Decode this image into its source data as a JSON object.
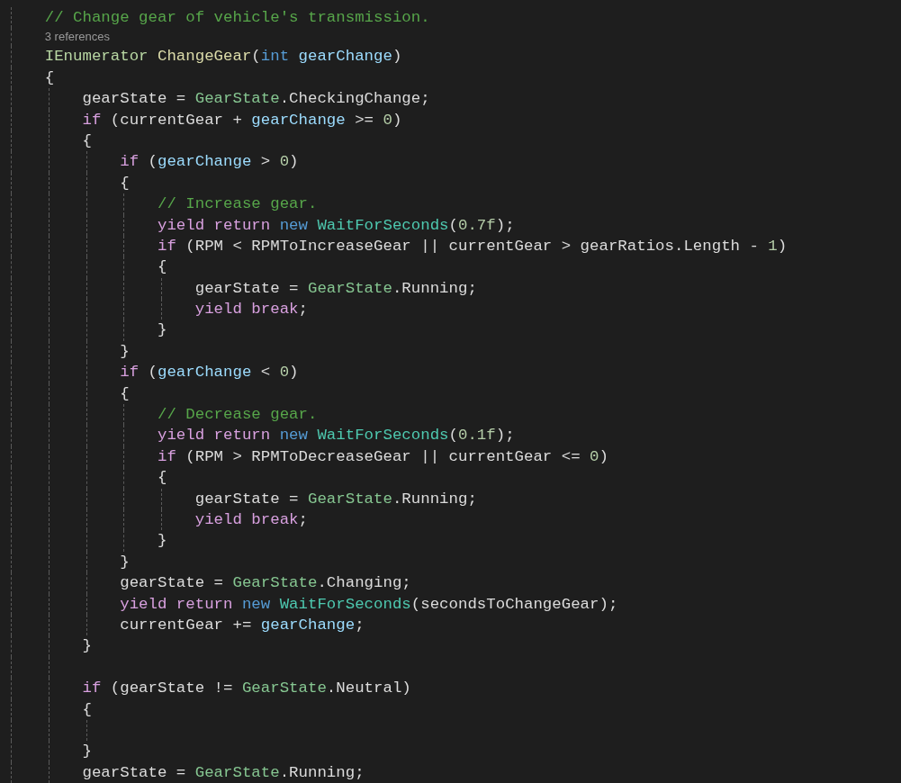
{
  "editor": {
    "lines": [
      {
        "kind": "code",
        "tokens": [
          {
            "text": "    // Change gear of vehicle's transmission.",
            "kind": "comment"
          }
        ]
      },
      {
        "kind": "codelens",
        "text": "3 references"
      },
      {
        "kind": "code",
        "tokens": [
          {
            "text": "    IEnumerator ",
            "kind": "interface"
          },
          {
            "text": "ChangeGear",
            "kind": "method"
          },
          {
            "text": "(",
            "kind": "plain"
          },
          {
            "text": "int ",
            "kind": "typekw"
          },
          {
            "text": "gearChange",
            "kind": "param"
          },
          {
            "text": ")",
            "kind": "plain"
          }
        ]
      },
      {
        "kind": "code",
        "tokens": [
          {
            "text": "    {",
            "kind": "plain"
          }
        ]
      },
      {
        "kind": "code",
        "tokens": [
          {
            "text": "        gearState = ",
            "kind": "plain"
          },
          {
            "text": "GearState",
            "kind": "enum"
          },
          {
            "text": ".CheckingChange;",
            "kind": "plain"
          }
        ]
      },
      {
        "kind": "code",
        "tokens": [
          {
            "text": "        if",
            "kind": "control"
          },
          {
            "text": " (currentGear + ",
            "kind": "plain"
          },
          {
            "text": "gearChange",
            "kind": "param"
          },
          {
            "text": " >= ",
            "kind": "plain"
          },
          {
            "text": "0",
            "kind": "number"
          },
          {
            "text": ")",
            "kind": "plain"
          }
        ]
      },
      {
        "kind": "code",
        "tokens": [
          {
            "text": "        {",
            "kind": "plain"
          }
        ]
      },
      {
        "kind": "code",
        "tokens": [
          {
            "text": "            if",
            "kind": "control"
          },
          {
            "text": " (",
            "kind": "plain"
          },
          {
            "text": "gearChange",
            "kind": "param"
          },
          {
            "text": " > ",
            "kind": "plain"
          },
          {
            "text": "0",
            "kind": "number"
          },
          {
            "text": ")",
            "kind": "plain"
          }
        ]
      },
      {
        "kind": "code",
        "tokens": [
          {
            "text": "            {",
            "kind": "plain"
          }
        ]
      },
      {
        "kind": "code",
        "tokens": [
          {
            "text": "                // Increase gear.",
            "kind": "comment"
          }
        ]
      },
      {
        "kind": "code",
        "tokens": [
          {
            "text": "                yield return ",
            "kind": "control"
          },
          {
            "text": "new ",
            "kind": "typekw"
          },
          {
            "text": "WaitForSeconds",
            "kind": "class"
          },
          {
            "text": "(",
            "kind": "plain"
          },
          {
            "text": "0.7f",
            "kind": "number"
          },
          {
            "text": ");",
            "kind": "plain"
          }
        ]
      },
      {
        "kind": "code",
        "tokens": [
          {
            "text": "                if",
            "kind": "control"
          },
          {
            "text": " (RPM < RPMToIncreaseGear || currentGear > gearRatios.Length - ",
            "kind": "plain"
          },
          {
            "text": "1",
            "kind": "number"
          },
          {
            "text": ")",
            "kind": "plain"
          }
        ]
      },
      {
        "kind": "code",
        "tokens": [
          {
            "text": "                {",
            "kind": "plain"
          }
        ]
      },
      {
        "kind": "code",
        "tokens": [
          {
            "text": "                    gearState = ",
            "kind": "plain"
          },
          {
            "text": "GearState",
            "kind": "enum"
          },
          {
            "text": ".Running;",
            "kind": "plain"
          }
        ]
      },
      {
        "kind": "code",
        "tokens": [
          {
            "text": "                    yield break",
            "kind": "control"
          },
          {
            "text": ";",
            "kind": "plain"
          }
        ]
      },
      {
        "kind": "code",
        "tokens": [
          {
            "text": "                }",
            "kind": "plain"
          }
        ]
      },
      {
        "kind": "code",
        "tokens": [
          {
            "text": "            }",
            "kind": "plain"
          }
        ]
      },
      {
        "kind": "code",
        "tokens": [
          {
            "text": "            if",
            "kind": "control"
          },
          {
            "text": " (",
            "kind": "plain"
          },
          {
            "text": "gearChange",
            "kind": "param"
          },
          {
            "text": " < ",
            "kind": "plain"
          },
          {
            "text": "0",
            "kind": "number"
          },
          {
            "text": ")",
            "kind": "plain"
          }
        ]
      },
      {
        "kind": "code",
        "tokens": [
          {
            "text": "            {",
            "kind": "plain"
          }
        ]
      },
      {
        "kind": "code",
        "tokens": [
          {
            "text": "                // Decrease gear.",
            "kind": "comment"
          }
        ]
      },
      {
        "kind": "code",
        "tokens": [
          {
            "text": "                yield return ",
            "kind": "control"
          },
          {
            "text": "new ",
            "kind": "typekw"
          },
          {
            "text": "WaitForSeconds",
            "kind": "class"
          },
          {
            "text": "(",
            "kind": "plain"
          },
          {
            "text": "0.1f",
            "kind": "number"
          },
          {
            "text": ");",
            "kind": "plain"
          }
        ]
      },
      {
        "kind": "code",
        "tokens": [
          {
            "text": "                if",
            "kind": "control"
          },
          {
            "text": " (RPM > RPMToDecreaseGear || currentGear <= ",
            "kind": "plain"
          },
          {
            "text": "0",
            "kind": "number"
          },
          {
            "text": ")",
            "kind": "plain"
          }
        ]
      },
      {
        "kind": "code",
        "tokens": [
          {
            "text": "                {",
            "kind": "plain"
          }
        ]
      },
      {
        "kind": "code",
        "tokens": [
          {
            "text": "                    gearState = ",
            "kind": "plain"
          },
          {
            "text": "GearState",
            "kind": "enum"
          },
          {
            "text": ".Running;",
            "kind": "plain"
          }
        ]
      },
      {
        "kind": "code",
        "tokens": [
          {
            "text": "                    yield break",
            "kind": "control"
          },
          {
            "text": ";",
            "kind": "plain"
          }
        ]
      },
      {
        "kind": "code",
        "tokens": [
          {
            "text": "                }",
            "kind": "plain"
          }
        ]
      },
      {
        "kind": "code",
        "tokens": [
          {
            "text": "            }",
            "kind": "plain"
          }
        ]
      },
      {
        "kind": "code",
        "tokens": [
          {
            "text": "            gearState = ",
            "kind": "plain"
          },
          {
            "text": "GearState",
            "kind": "enum"
          },
          {
            "text": ".Changing;",
            "kind": "plain"
          }
        ]
      },
      {
        "kind": "code",
        "tokens": [
          {
            "text": "            yield return ",
            "kind": "control"
          },
          {
            "text": "new ",
            "kind": "typekw"
          },
          {
            "text": "WaitForSeconds",
            "kind": "class"
          },
          {
            "text": "(secondsToChangeGear);",
            "kind": "plain"
          }
        ]
      },
      {
        "kind": "code",
        "tokens": [
          {
            "text": "            currentGear += ",
            "kind": "plain"
          },
          {
            "text": "gearChange",
            "kind": "param"
          },
          {
            "text": ";",
            "kind": "plain"
          }
        ]
      },
      {
        "kind": "code",
        "tokens": [
          {
            "text": "        }",
            "kind": "plain"
          }
        ]
      },
      {
        "kind": "blank"
      },
      {
        "kind": "code",
        "tokens": [
          {
            "text": "        if",
            "kind": "control"
          },
          {
            "text": " (gearState != ",
            "kind": "plain"
          },
          {
            "text": "GearState",
            "kind": "enum"
          },
          {
            "text": ".Neutral)",
            "kind": "plain"
          }
        ]
      },
      {
        "kind": "code",
        "tokens": [
          {
            "text": "        {",
            "kind": "plain"
          }
        ]
      },
      {
        "kind": "blank"
      },
      {
        "kind": "code",
        "tokens": [
          {
            "text": "        }",
            "kind": "plain"
          }
        ]
      },
      {
        "kind": "code",
        "tokens": [
          {
            "text": "        gearState = ",
            "kind": "plain"
          },
          {
            "text": "GearState",
            "kind": "enum"
          },
          {
            "text": ".Running;",
            "kind": "plain"
          }
        ]
      }
    ]
  }
}
